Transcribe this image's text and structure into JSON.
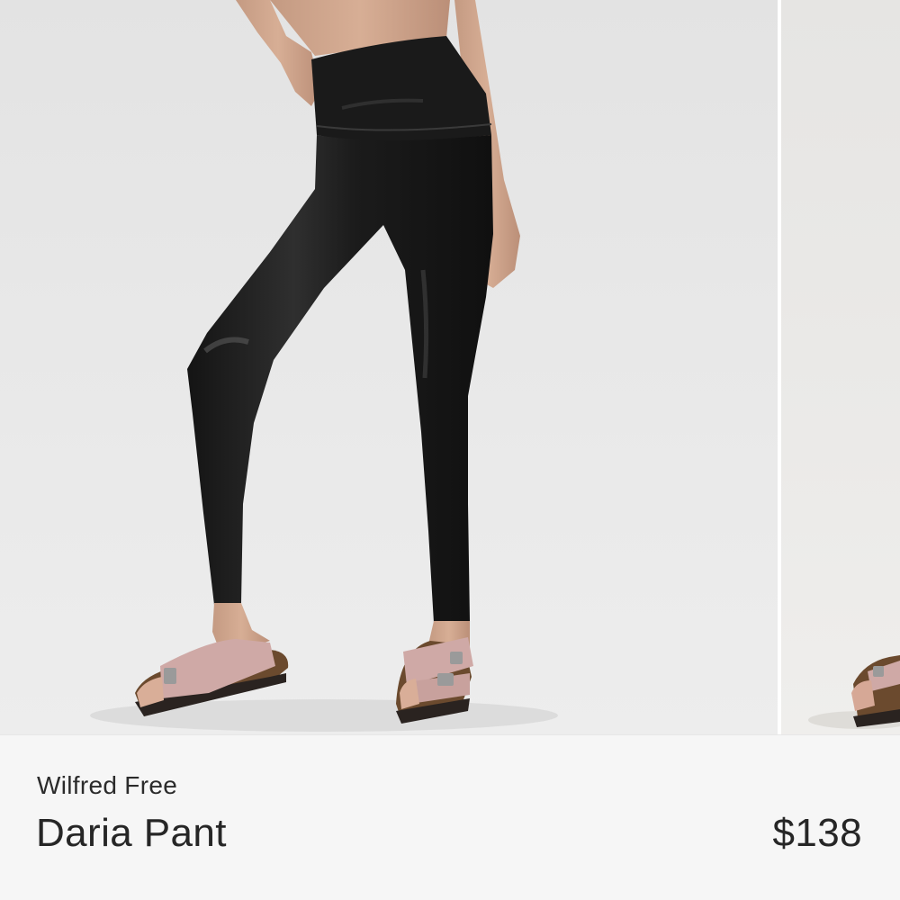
{
  "product": {
    "brand": "Wilfred Free",
    "name": "Daria Pant",
    "price": "$138"
  },
  "gallery": {
    "images": [
      {
        "subject": "model wearing black faux-leather high-rise leggings with pink suede buckle sandals",
        "icon": "product-photo-icon"
      },
      {
        "subject": "partially visible next product photo showing a sandal",
        "icon": "product-photo-icon"
      }
    ]
  },
  "colors": {
    "panel_background": "#f6f6f6",
    "text": "#262626",
    "photo_background": "#e8e8e8",
    "legging_black": "#1e1e1e",
    "sandal_pink": "#cfa9a6"
  }
}
